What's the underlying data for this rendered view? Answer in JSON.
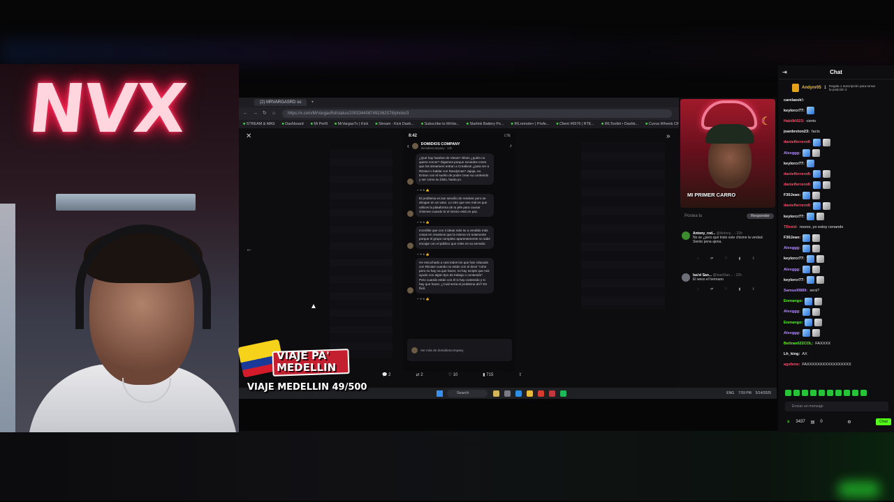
{
  "stream": {
    "neon_sign": "NVX",
    "sticker_text": "VIAJE PA' MEDELLIN",
    "goal_text": "VIAJE MEDELLIN 49/500",
    "cam2_caption": "MI PRIMER CARRO"
  },
  "browser": {
    "tab_title": "(2) MRVARGASRD so",
    "url": "https://x.com/MrVargasRd/status/2003344087491062578/photo/3",
    "bookmarks": [
      "STREAM & MAS",
      "Dashboard",
      "Mi Perfil",
      "MrVargasTv | Kick",
      "Stream - Kick Dash...",
      "Subscribe to MrVar...",
      "Starlink Battery Po...",
      "IRLremote+ | Profe...",
      "Client #6576 | RTE...",
      "IRLToolkit • Dashb...",
      "Cuvva Wheels CF78"
    ]
  },
  "phone": {
    "time": "8:42",
    "signal": "LTE",
    "account": "DOMIDIOS COMPANY",
    "handle": "domidioscompany · 13h",
    "messages": [
      "¿Qué hay hambre de Views? Obvio ¿quién no quiere crecer? Digamos porque sociedes crees que los streamers entran a Creativos ¿para ver a RDJavi o hablar con Randymas? Jajaja, no. Entran con el sueño de poder crear su contenido y ser como su ídolo, hasta yo.",
      "El problema es tan sencillo de resolver pero se ahogan en un vaso. Lo otro que veo mal es que utilices la plataforma de tu jefe para causar chismes cuando tú el mismo está en paz.",
      "Increíble que con 2 ideas más se a vendido más cosas en creativos que la misma V2 solamente porque el grupo completo aparentemente no sabe encajar con el público que roles en su servidor.",
      "He escuchado a casi todos los que han rolacado con RDJavi cuando no están con el decir \"cohe pero no hay na que hacer, no hay scripts que nos ayudo con algún tipo de trabajo o contenido\". Pero cuando están con él si hay contenido y si hay que hacer. ¿Cuál sería el problema ahí? Es fácil."
    ],
    "reply_placeholder": "Ver más de domidioscompany"
  },
  "post_actions": {
    "replies": "2",
    "reposts": "2",
    "likes": "10",
    "views": "715"
  },
  "side_panel": {
    "post_placeholder": "Postea tu",
    "reply_button": "Responder",
    "comments": [
      {
        "user": "Antony_rod...",
        "handle": "@Antony...",
        "age": "22h",
        "text": "No se ¿pero qué triste este chisme la verdad. Siento pena ajena."
      },
      {
        "user": "Isa'el San...",
        "handle": "@IsaelSan...",
        "age": "22h",
        "text": "El weso el hermano"
      }
    ]
  },
  "taskbar": {
    "search": "Search",
    "lang": "ENG",
    "time": "7:59 PM",
    "date": "5/14/2025"
  },
  "chat": {
    "title": "Chat",
    "gift_user": "Andynr05",
    "gift_count": "1",
    "gift_note": "Regala 1 suscripción para tomar la posición 2",
    "lines": [
      {
        "user": "carelaeek!:",
        "text": "",
        "color": "#f3f3f5",
        "emotes": 0
      },
      {
        "user": "keylorcr77:",
        "text": "",
        "color": "#f3f3f5",
        "emotes": 1
      },
      {
        "user": "Habilkl023:",
        "text": "cierto",
        "color": "#ff4d6a",
        "emotes": 0
      },
      {
        "user": "joanbreton23:",
        "text": "facts",
        "color": "#f3f3f5",
        "emotes": 0
      },
      {
        "user": "danielferrero8:",
        "text": "",
        "color": "#ff4d6a",
        "emotes": 2
      },
      {
        "user": "Alexggg:",
        "text": "",
        "color": "#b58cff",
        "emotes": 2
      },
      {
        "user": "keylorcr77:",
        "text": "",
        "color": "#f3f3f5",
        "emotes": 1
      },
      {
        "user": "danielferrero8:",
        "text": "",
        "color": "#ff4d6a",
        "emotes": 2
      },
      {
        "user": "danielferrero8:",
        "text": "",
        "color": "#ff4d6a",
        "emotes": 2
      },
      {
        "user": "F30Jean:",
        "text": "",
        "color": "#f3f3f5",
        "emotes": 2
      },
      {
        "user": "danielferrero8:",
        "text": "",
        "color": "#ff4d6a",
        "emotes": 2
      },
      {
        "user": "keylorcr77:",
        "text": "",
        "color": "#f3f3f5",
        "emotes": 2
      },
      {
        "user": "TDroid:",
        "text": "noooo, yo estoy cenando",
        "color": "#ff4d6a",
        "emotes": 0
      },
      {
        "user": "F30Jean:",
        "text": "",
        "color": "#f3f3f5",
        "emotes": 2
      },
      {
        "user": "Alexggg:",
        "text": "",
        "color": "#b58cff",
        "emotes": 2
      },
      {
        "user": "keylorcr77:",
        "text": "",
        "color": "#f3f3f5",
        "emotes": 2
      },
      {
        "user": "Alexggg:",
        "text": "",
        "color": "#b58cff",
        "emotes": 2
      },
      {
        "user": "keylorcr77:",
        "text": "",
        "color": "#f3f3f5",
        "emotes": 2
      },
      {
        "user": "Samuel0889:",
        "text": "será?",
        "color": "#b58cff",
        "emotes": 0
      },
      {
        "user": "Enmango:",
        "text": "",
        "color": "#53fc18",
        "emotes": 2
      },
      {
        "user": "Alexggg:",
        "text": "",
        "color": "#b58cff",
        "emotes": 2
      },
      {
        "user": "Enmango:",
        "text": "",
        "color": "#53fc18",
        "emotes": 2
      },
      {
        "user": "Alexggg:",
        "text": "",
        "color": "#b58cff",
        "emotes": 2
      },
      {
        "user": "Beltran022COL:",
        "text": "FAXXXX",
        "color": "#53fc18",
        "emotes": 0
      },
      {
        "user": "Lh_king:",
        "text": "AX",
        "color": "#f3f3f5",
        "emotes": 0
      },
      {
        "user": "agshmo:",
        "text": "FAXXXXXXXXXXXXXXXXX",
        "color": "#ff4d6a",
        "emotes": 0
      }
    ],
    "input_placeholder": "Enviar un mensaje",
    "points": "3437",
    "gifts": "0",
    "chat_button": "Chat"
  }
}
